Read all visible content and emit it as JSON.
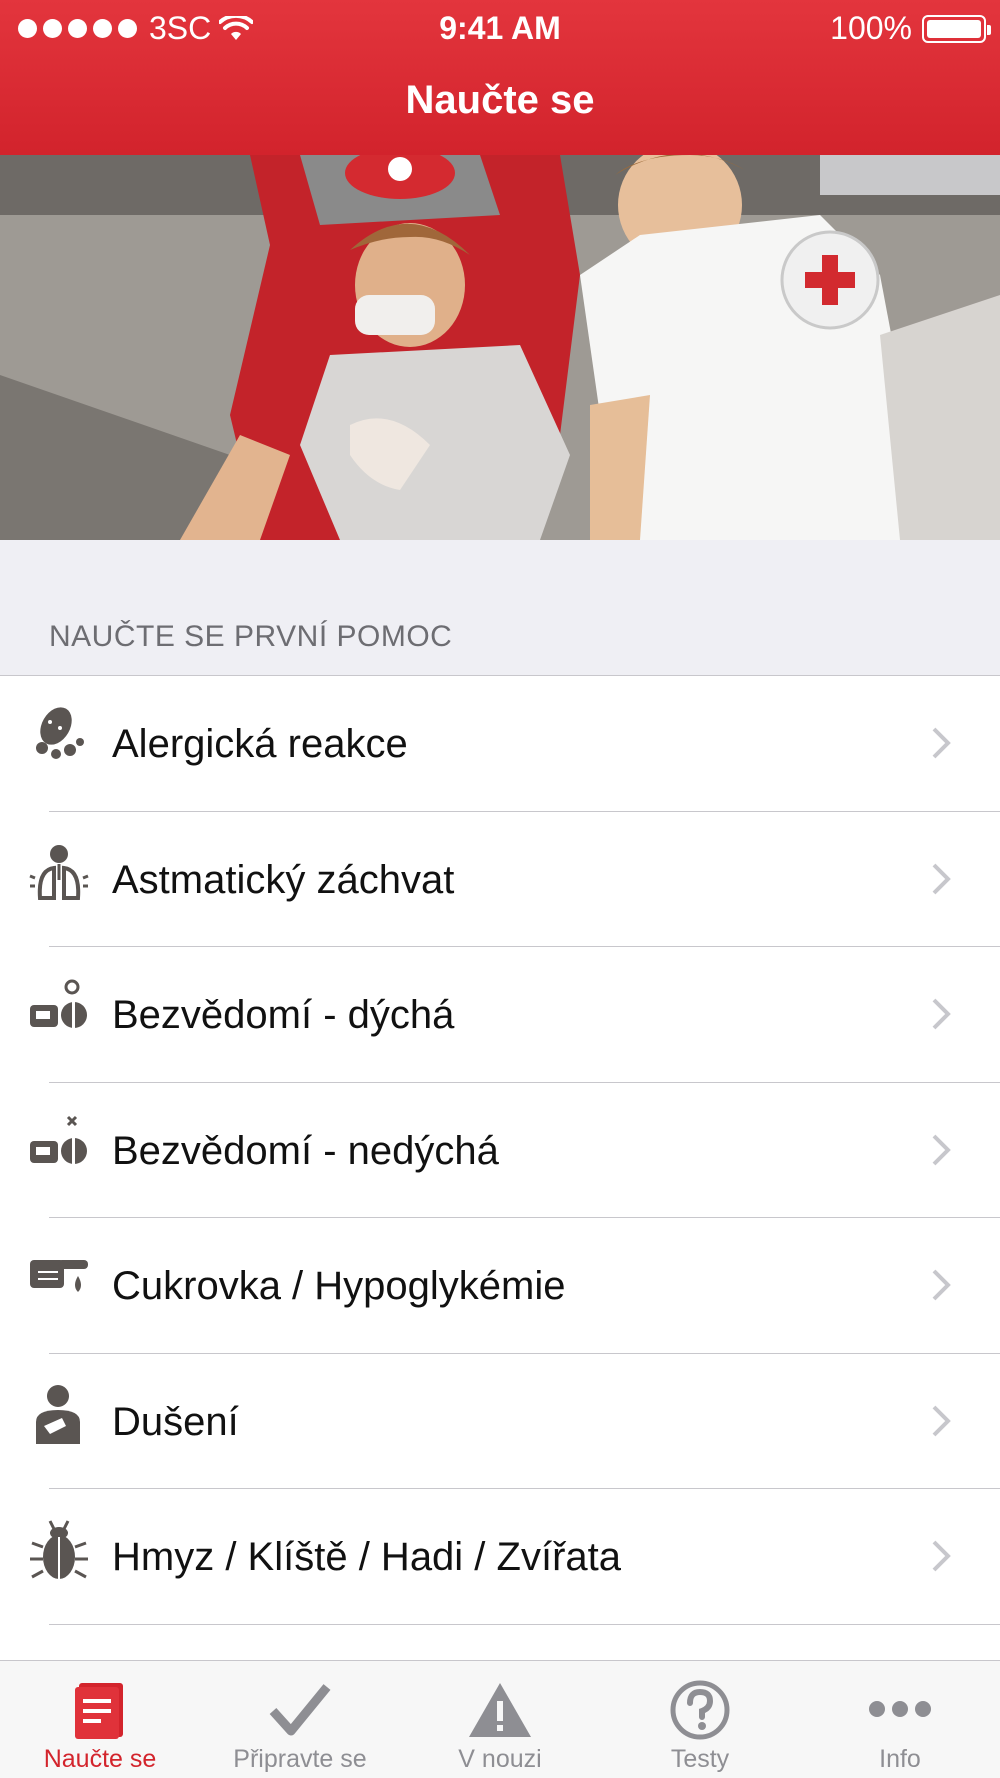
{
  "status_bar": {
    "carrier": "3SC",
    "time": "9:41 AM",
    "battery": "100%"
  },
  "nav": {
    "title": "Naučte se"
  },
  "hero": {
    "alt": "first-aid-training-photo"
  },
  "section": {
    "title": "NAUČTE SE PRVNÍ POMOC"
  },
  "list": {
    "items": [
      {
        "label": "Alergická reakce",
        "icon": "peanut-icon"
      },
      {
        "label": "Astmatický záchvat",
        "icon": "lungs-icon"
      },
      {
        "label": "Bezvědomí - dýchá",
        "icon": "unconscious-breathing-icon"
      },
      {
        "label": "Bezvědomí - nedýchá",
        "icon": "unconscious-not-breathing-icon"
      },
      {
        "label": "Cukrovka / Hypoglykémie",
        "icon": "finger-drop-icon"
      },
      {
        "label": "Dušení",
        "icon": "choking-icon"
      },
      {
        "label": "Hmyz / Klíště / Hadi / Zvířata",
        "icon": "bug-icon"
      }
    ]
  },
  "tabbar": {
    "tabs": [
      {
        "label": "Naučte se",
        "icon": "book-icon",
        "active": true
      },
      {
        "label": "Připravte se",
        "icon": "checkmark-icon",
        "active": false
      },
      {
        "label": "V nouzi",
        "icon": "warning-icon",
        "active": false
      },
      {
        "label": "Testy",
        "icon": "question-icon",
        "active": false
      },
      {
        "label": "Info",
        "icon": "more-icon",
        "active": false
      }
    ]
  },
  "colors": {
    "accent": "#d3242c",
    "inactive": "#8e8e93",
    "icon": "#5a5552"
  }
}
